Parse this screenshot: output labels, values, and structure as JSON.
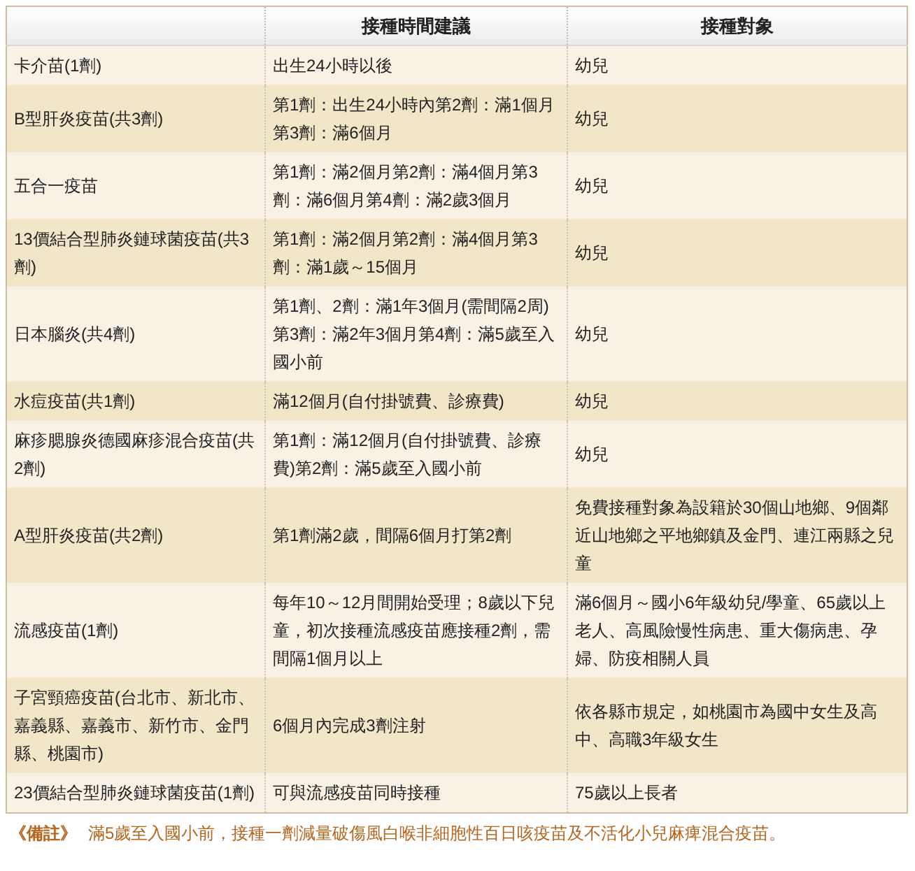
{
  "table": {
    "columns": [
      "",
      "接種時間建議",
      "接種對象"
    ],
    "rows": [
      [
        "卡介苗(1劑)",
        "出生24小時以後",
        "幼兒"
      ],
      [
        "B型肝炎疫苗(共3劑)",
        "第1劑：出生24小時內第2劑：滿1個月第3劑：滿6個月",
        "幼兒"
      ],
      [
        "五合一疫苗",
        "第1劑：滿2個月第2劑：滿4個月第3劑：滿6個月第4劑：滿2歲3個月",
        "幼兒"
      ],
      [
        "13價結合型肺炎鏈球菌疫苗(共3劑)",
        "第1劑：滿2個月第2劑：滿4個月第3劑：滿1歲～15個月",
        "幼兒"
      ],
      [
        "日本腦炎(共4劑)",
        "第1劑、2劑：滿1年3個月(需間隔2周)第3劑：滿2年3個月第4劑：滿5歲至入國小前",
        "幼兒"
      ],
      [
        "水痘疫苗(共1劑)",
        "滿12個月(自付掛號費、診療費)",
        "幼兒"
      ],
      [
        "麻疹腮腺炎德國麻疹混合疫苗(共2劑)",
        "第1劑：滿12個月(自付掛號費、診療費)第2劑：滿5歲至入國小前",
        "幼兒"
      ],
      [
        "A型肝炎疫苗(共2劑)",
        "第1劑滿2歲，間隔6個月打第2劑",
        "免費接種對象為設籍於30個山地鄉、9個鄰近山地鄉之平地鄉鎮及金門、連江兩縣之兒童"
      ],
      [
        "流感疫苗(1劑)",
        "每年10～12月間開始受理；8歲以下兒童，初次接種流感疫苗應接種2劑，需間隔1個月以上",
        "滿6個月～國小6年級幼兒/學童、65歲以上老人、高風險慢性病患、重大傷病患、孕婦、防疫相關人員"
      ],
      [
        "子宮頸癌疫苗(台北市、新北市、嘉義縣、嘉義市、新竹市、金門縣、桃園市)",
        "6個月內完成3劑注射",
        "依各縣市規定，如桃園市為國中女生及高中、高職3年級女生"
      ],
      [
        "23價結合型肺炎鏈球菌疫苗(1劑)",
        "可與流感疫苗同時接種",
        "75歲以上長者"
      ]
    ]
  },
  "note": {
    "label": "《備註》",
    "text": "滿5歲至入國小前，接種一劑減量破傷風白喉非細胞性百日咳疫苗及不活化小兒麻痺混合疫苗。"
  }
}
